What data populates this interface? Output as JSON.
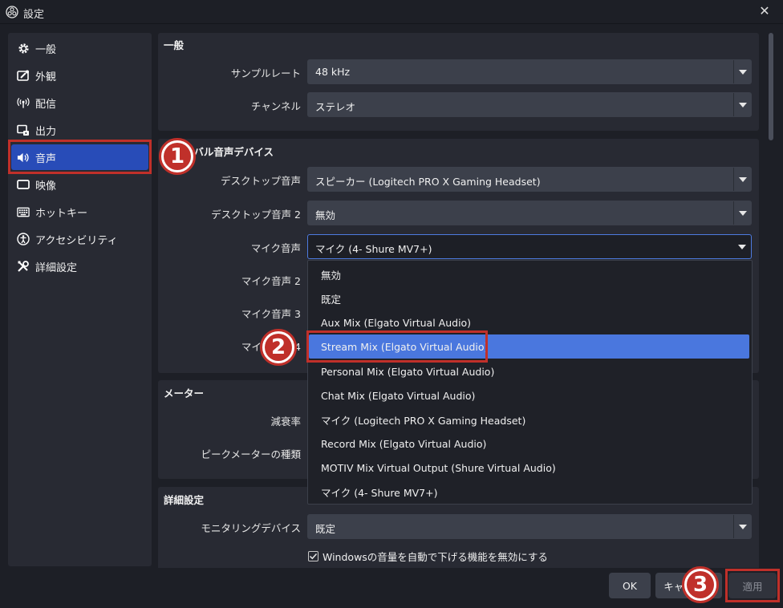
{
  "window": {
    "title": "設定",
    "close_glyph": "✕"
  },
  "sidebar": {
    "items": [
      {
        "label": "一般",
        "icon": "gear-icon"
      },
      {
        "label": "外観",
        "icon": "appearance-icon"
      },
      {
        "label": "配信",
        "icon": "broadcast-icon"
      },
      {
        "label": "出力",
        "icon": "output-icon"
      },
      {
        "label": "音声",
        "icon": "speaker-icon",
        "active": true
      },
      {
        "label": "映像",
        "icon": "monitor-icon"
      },
      {
        "label": "ホットキー",
        "icon": "keyboard-icon"
      },
      {
        "label": "アクセシビリティ",
        "icon": "accessibility-icon"
      },
      {
        "label": "詳細設定",
        "icon": "tools-icon"
      }
    ]
  },
  "general": {
    "title": "一般",
    "sample_rate": {
      "label": "サンプルレート",
      "value": "48 kHz"
    },
    "channels": {
      "label": "チャンネル",
      "value": "ステレオ"
    }
  },
  "devices": {
    "title": "グローバル音声デバイス",
    "desktop1": {
      "label": "デスクトップ音声",
      "value": "スピーカー (Logitech PRO X Gaming Headset)"
    },
    "desktop2": {
      "label": "デスクトップ音声 2",
      "value": "無効"
    },
    "mic1": {
      "label": "マイク音声",
      "value": "マイク (4- Shure MV7+)"
    },
    "mic2": {
      "label": "マイク音声 2"
    },
    "mic3": {
      "label": "マイク音声 3"
    },
    "mic4": {
      "label": "マイク音声 4"
    }
  },
  "dropdown": {
    "options": [
      "無効",
      "既定",
      "Aux Mix (Elgato Virtual Audio)",
      "Stream Mix (Elgato Virtual Audio)",
      "Personal Mix (Elgato Virtual Audio)",
      "Chat Mix (Elgato Virtual Audio)",
      "マイク (Logitech PRO X Gaming Headset)",
      "Record Mix (Elgato Virtual Audio)",
      "MOTIV Mix Virtual Output (Shure Virtual Audio)",
      "マイク (4- Shure MV7+)"
    ],
    "highlighted_index": 3
  },
  "meters": {
    "title": "メーター",
    "decay": {
      "label": "減衰率"
    },
    "peak": {
      "label": "ピークメーターの種類"
    }
  },
  "advanced": {
    "title": "詳細設定",
    "monitoring": {
      "label": "モニタリングデバイス",
      "value": "既定"
    },
    "ducking": {
      "label": "Windowsの音量を自動で下げる機能を無効にする",
      "checked": true
    }
  },
  "buttons": {
    "ok": "OK",
    "cancel": "キャンセル",
    "apply": "適用"
  },
  "annotations": {
    "step1": "1",
    "step2": "2",
    "step3": "3",
    "color": "#c0302a"
  },
  "colors": {
    "accent": "#284cb8",
    "highlight": "#4a77de",
    "background": "#1d1f26"
  }
}
